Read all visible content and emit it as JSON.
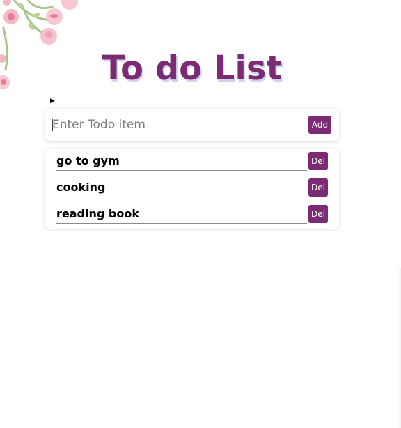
{
  "title": "To do List",
  "input": {
    "placeholder": "Enter Todo item",
    "value": "",
    "add_label": "Add"
  },
  "todos": [
    {
      "text": "go to gym",
      "delete_label": "Del"
    },
    {
      "text": "cooking",
      "delete_label": "Del"
    },
    {
      "text": "reading book",
      "delete_label": "Del"
    }
  ],
  "colors": {
    "accent": "#7b2b74",
    "title_shadow": "#cfd3ee",
    "flower_pink": "#f3b8c6",
    "stem_green": "#a9c48a"
  },
  "icons": {
    "decoration": "floral-corner-illustration",
    "disclosure": "triangle-right-icon"
  }
}
